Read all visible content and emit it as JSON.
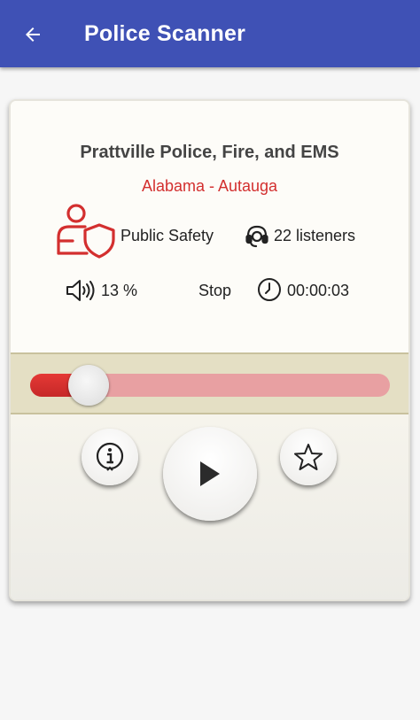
{
  "app_bar": {
    "title": "Police Scanner",
    "back_icon": "arrow-back-icon",
    "color": "#3f51b5"
  },
  "feed": {
    "title": "Prattville Police, Fire, and EMS",
    "location": "Alabama - Autauga",
    "category": "Public Safety",
    "category_icon": "public-safety-icon",
    "listeners": "22 listeners",
    "listeners_icon": "headset-icon",
    "volume": "13 %",
    "volume_icon": "speaker-icon",
    "stop_label": "Stop",
    "elapsed": "00:00:03",
    "timer_icon": "clock-icon"
  },
  "seek_bar": {
    "progress": 0.13,
    "fill_color": "#e53935",
    "track_color": "#e8a0a2"
  },
  "controls": {
    "info_icon": "info-icon",
    "play_icon": "play-icon",
    "favorite_icon": "star-outline-icon"
  },
  "colors": {
    "accent_red": "#d32f2f",
    "band": "#e4dfc4"
  }
}
